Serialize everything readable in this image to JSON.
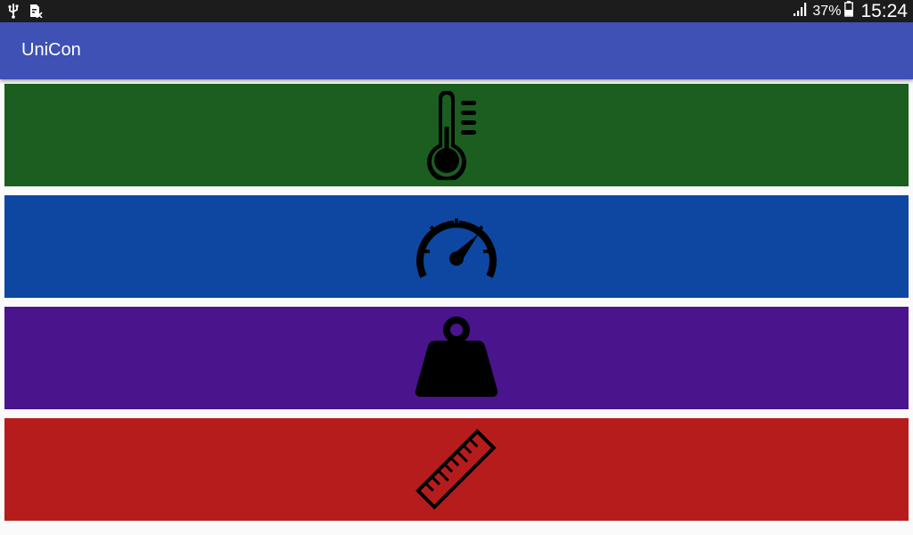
{
  "status_bar": {
    "icons": [
      "usb-icon",
      "sim-card-disabled-icon",
      "signal-icon",
      "battery-icon"
    ],
    "battery_percent": "37%",
    "time": "15:24"
  },
  "app_bar": {
    "title": "UniCon",
    "color": "#3f51b5"
  },
  "categories": [
    {
      "icon": "thermometer-icon",
      "color": "#1b5e20"
    },
    {
      "icon": "speedometer-icon",
      "color": "#0d47a1"
    },
    {
      "icon": "weight-icon",
      "color": "#4a148c"
    },
    {
      "icon": "ruler-icon",
      "color": "#b71c1c"
    }
  ]
}
